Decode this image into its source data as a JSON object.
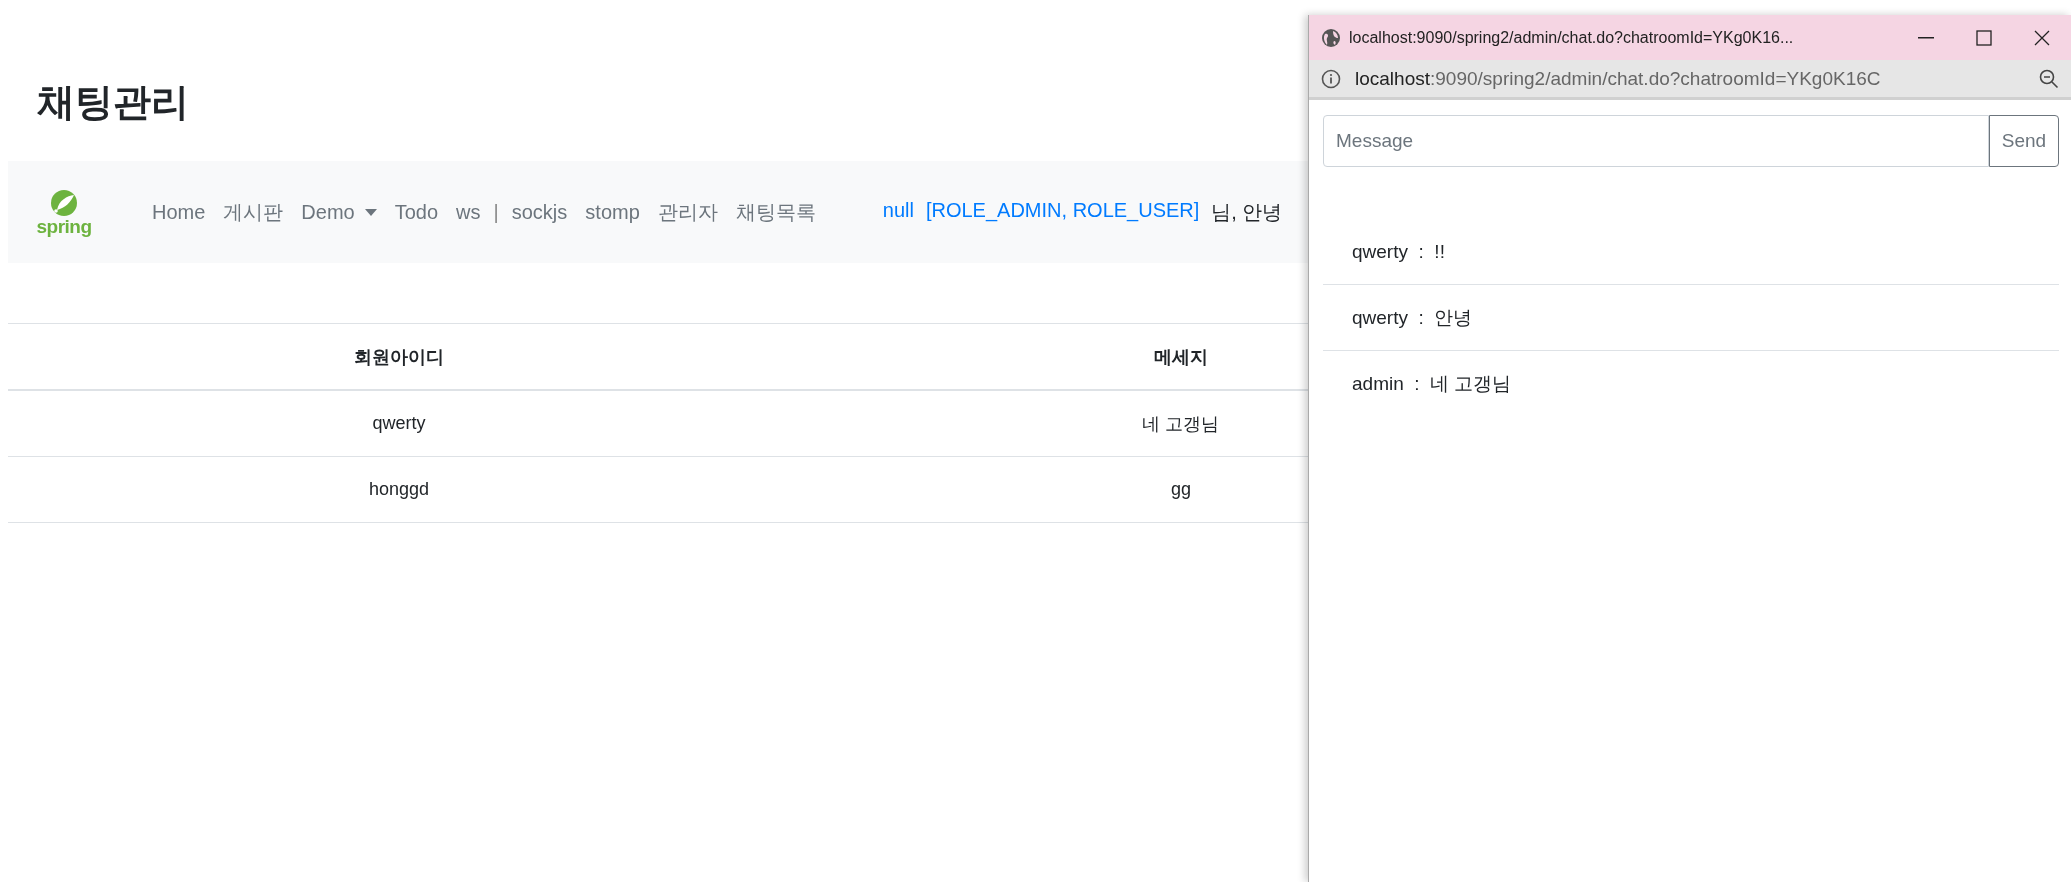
{
  "page_title": "채팅관리",
  "navbar": {
    "brand": "spring",
    "items": [
      {
        "label": "Home",
        "kind": "link"
      },
      {
        "label": "게시판",
        "kind": "link"
      },
      {
        "label": "Demo",
        "kind": "dropdown"
      },
      {
        "label": "Todo",
        "kind": "link"
      },
      {
        "label": "ws",
        "kind": "link"
      },
      {
        "label": "|",
        "kind": "separator"
      },
      {
        "label": "sockjs",
        "kind": "link"
      },
      {
        "label": "stomp",
        "kind": "link"
      },
      {
        "label": "관리자",
        "kind": "link"
      },
      {
        "label": "채팅목록",
        "kind": "link"
      }
    ],
    "user": "null",
    "roles": "[ROLE_ADMIN, ROLE_USER]",
    "greeting": "님, 안녕"
  },
  "table": {
    "columns": [
      "회원아이디",
      "메세지"
    ],
    "rows": [
      [
        "qwerty",
        "네 고갱님"
      ],
      [
        "honggd",
        "gg"
      ]
    ]
  },
  "popup": {
    "title": "localhost:9090/spring2/admin/chat.do?chatroomId=YKg0K16...",
    "address_host": "localhost",
    "address_rest": ":9090/spring2/admin/chat.do?chatroomId=YKg0K16C",
    "message_placeholder": "Message",
    "send_label": "Send",
    "messages": [
      {
        "sender": "qwerty",
        "separator": ":",
        "text": "!!"
      },
      {
        "sender": "qwerty",
        "separator": ":",
        "text": "안녕"
      },
      {
        "sender": "admin",
        "separator": ":",
        "text": "네 고갱님"
      }
    ]
  }
}
